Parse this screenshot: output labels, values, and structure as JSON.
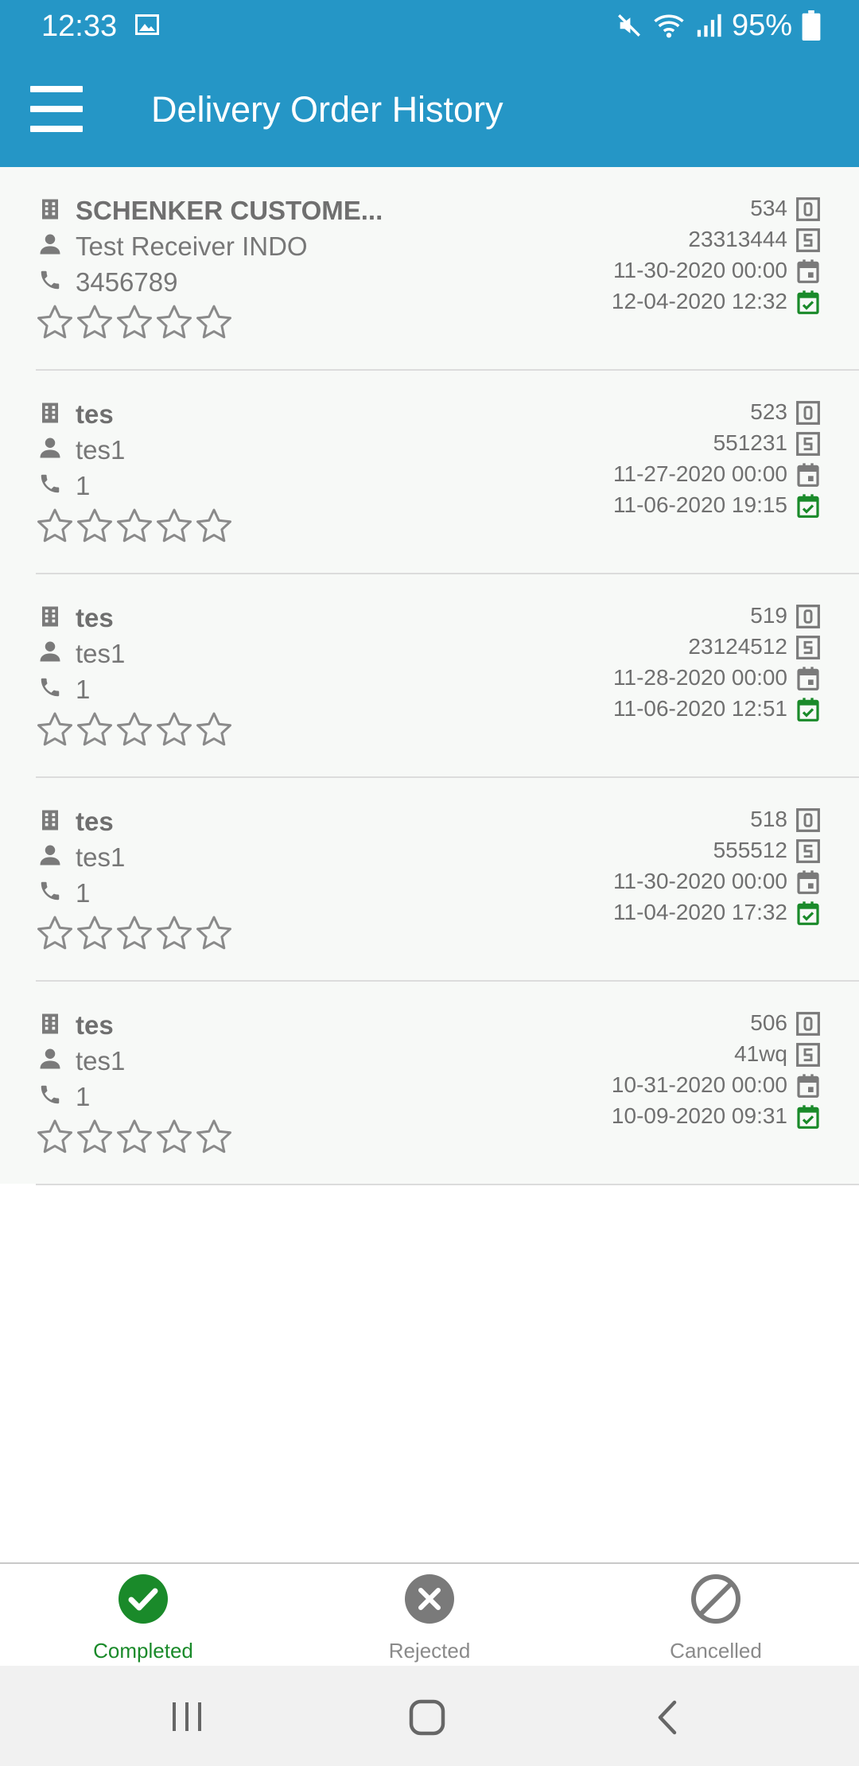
{
  "status_bar": {
    "time": "12:33",
    "battery": "95%"
  },
  "app_bar": {
    "title": "Delivery Order History"
  },
  "colors": {
    "primary": "#2596c6",
    "completed": "#1a8a2a",
    "inactive": "#7a7a7a",
    "icon_gray": "#7a7a7a"
  },
  "orders": [
    {
      "name": "SCHENKER CUSTOME...",
      "receiver": "Test Receiver INDO",
      "phone": "3456789",
      "order_id": "534",
      "shipment": "23313444",
      "scheduled": "11-30-2020 00:00",
      "completed": "12-04-2020 12:32",
      "rating": 0
    },
    {
      "name": "tes",
      "receiver": "tes1",
      "phone": "1",
      "order_id": "523",
      "shipment": "551231",
      "scheduled": "11-27-2020 00:00",
      "completed": "11-06-2020 19:15",
      "rating": 0
    },
    {
      "name": "tes",
      "receiver": "tes1",
      "phone": "1",
      "order_id": "519",
      "shipment": "23124512",
      "scheduled": "11-28-2020 00:00",
      "completed": "11-06-2020 12:51",
      "rating": 0
    },
    {
      "name": "tes",
      "receiver": "tes1",
      "phone": "1",
      "order_id": "518",
      "shipment": "555512",
      "scheduled": "11-30-2020 00:00",
      "completed": "11-04-2020 17:32",
      "rating": 0
    },
    {
      "name": "tes",
      "receiver": "tes1",
      "phone": "1",
      "order_id": "506",
      "shipment": "41wq",
      "scheduled": "10-31-2020 00:00",
      "completed": "10-09-2020 09:31",
      "rating": 0
    }
  ],
  "bottom_nav": [
    {
      "label": "Completed",
      "icon": "check-circle-icon",
      "active": true
    },
    {
      "label": "Rejected",
      "icon": "x-circle-icon",
      "active": false
    },
    {
      "label": "Cancelled",
      "icon": "ban-icon",
      "active": false
    }
  ],
  "system_nav": [
    "recents-icon",
    "home-icon",
    "back-icon"
  ]
}
